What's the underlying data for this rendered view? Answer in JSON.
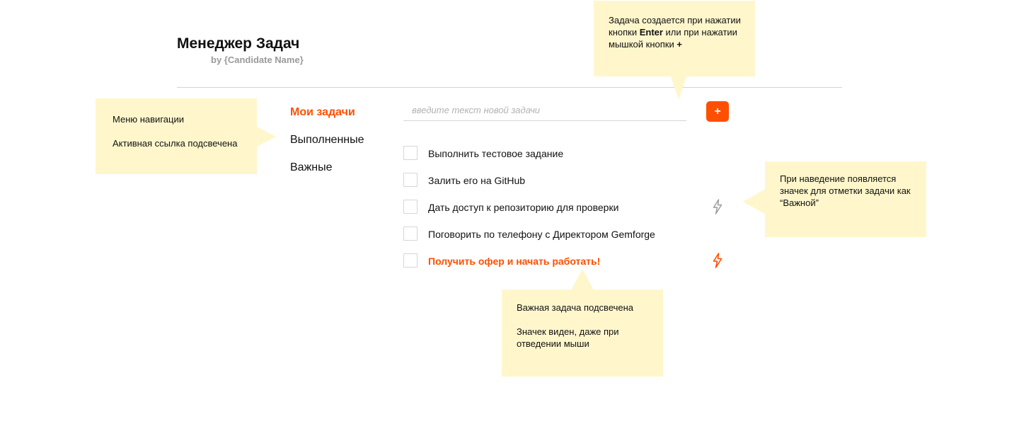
{
  "header": {
    "title": "Менеджер Задач",
    "subtitle": "by {Candidate Name}"
  },
  "nav": {
    "items": [
      {
        "label": "Мои задачи",
        "active": true
      },
      {
        "label": "Выполненные",
        "active": false
      },
      {
        "label": "Важные",
        "active": false
      }
    ]
  },
  "new_task": {
    "placeholder": "введите текст новой задачи",
    "add_button_label": "+"
  },
  "tasks": [
    {
      "text": "Выполнить тестовое задание",
      "done": false,
      "important": false,
      "bolt_icon": null
    },
    {
      "text": "Залить его на GitHub",
      "done": false,
      "important": false,
      "bolt_icon": null
    },
    {
      "text": "Дать доступ к репозиторию для проверки",
      "done": false,
      "important": false,
      "bolt_icon": "bolt-outline-icon"
    },
    {
      "text": "Поговорить по телефону с Директором Gemforge",
      "done": false,
      "important": false,
      "bolt_icon": null
    },
    {
      "text": "Получить офер и начать работать!",
      "done": false,
      "important": true,
      "bolt_icon": "bolt-active-icon"
    }
  ],
  "tooltips": {
    "create": {
      "part1": "Задача создается при нажатии кнопки ",
      "key1": "Enter",
      "part2": " или при нажатии мышкой кнопки ",
      "key2": "+"
    },
    "nav": {
      "line1": "Меню навигации",
      "line2": "Активная ссылка подсвечена"
    },
    "hover": {
      "text": "При наведение появляется значек для отметки задачи как “Важной”"
    },
    "important": {
      "line1": "Важная задача подсвечена",
      "line2": "Значек виден, даже при отведении мыши"
    }
  },
  "colors": {
    "accent": "#ff4f00",
    "tooltip_bg": "#fff6cc",
    "muted_text": "#9a9a9a",
    "divider": "#d4d4d4",
    "bolt_inactive": "#9a9a9a"
  }
}
